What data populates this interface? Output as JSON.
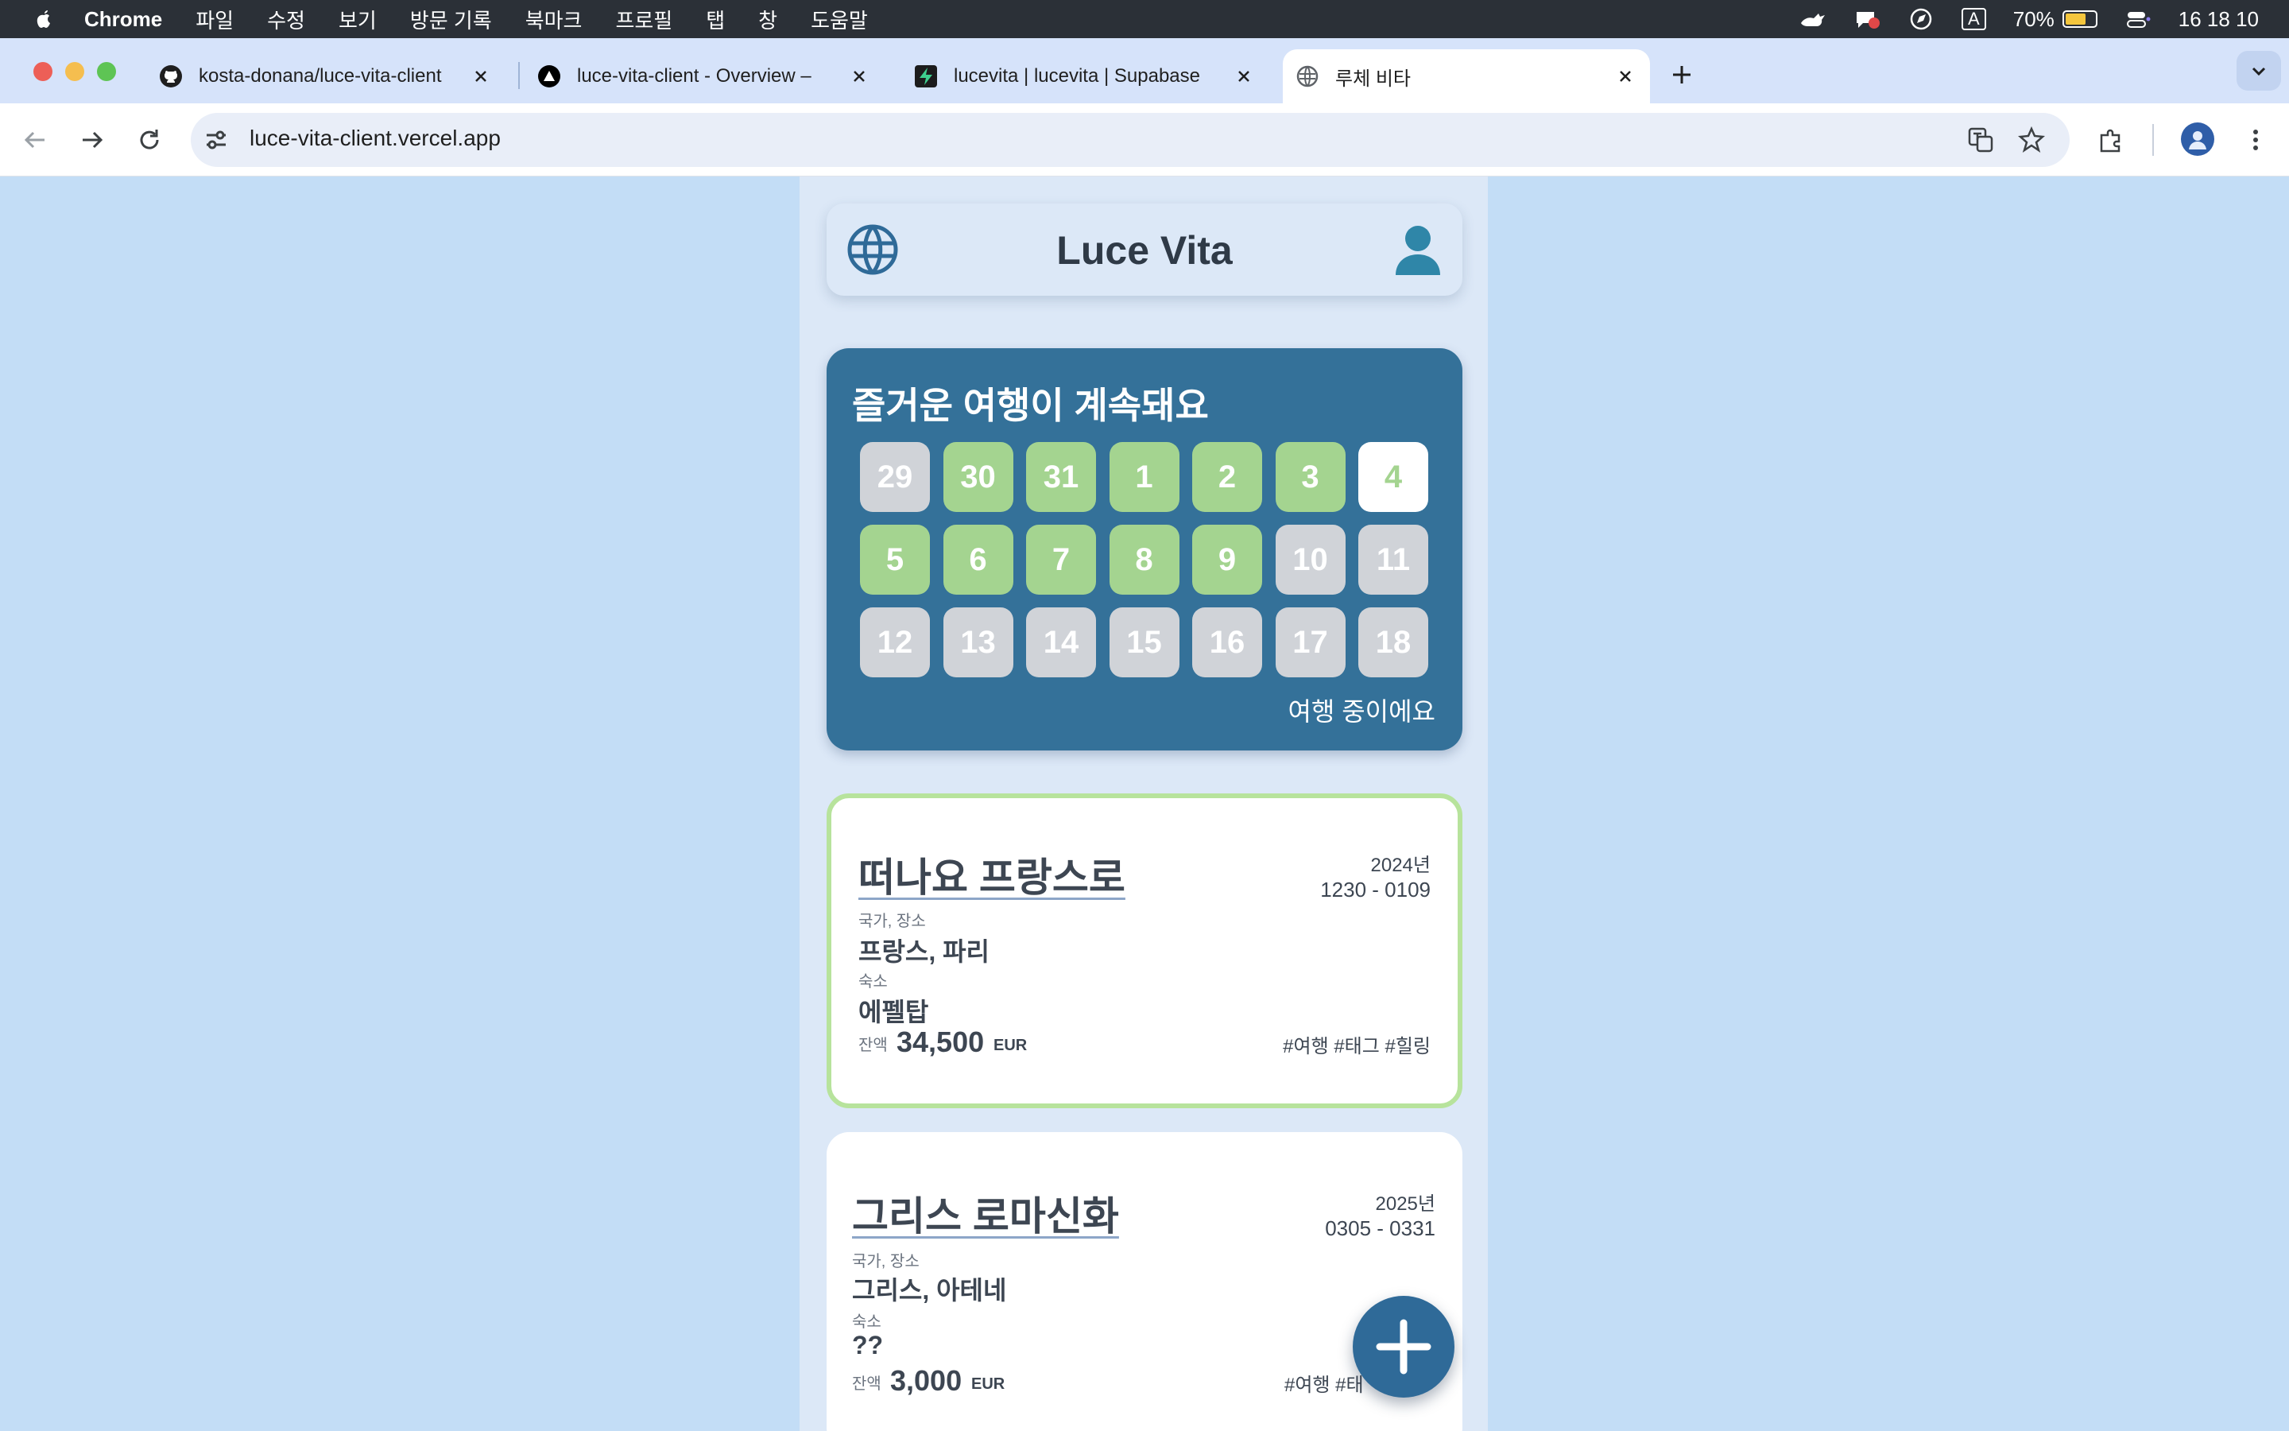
{
  "menubar": {
    "app": "Chrome",
    "items": [
      "파일",
      "수정",
      "보기",
      "방문 기록",
      "북마크",
      "프로필",
      "탭",
      "창",
      "도움말"
    ],
    "battery_percent": "70%",
    "battery_level": 0.7,
    "input_source": "A",
    "clock": "16 18 10"
  },
  "tabs": [
    {
      "title": "kosta-donana/luce-vita-client",
      "icon": "github-icon"
    },
    {
      "title": "luce-vita-client - Overview –",
      "icon": "vercel-icon"
    },
    {
      "title": "lucevita | lucevita | Supabase",
      "icon": "supabase-icon"
    },
    {
      "title": "루체 비타",
      "icon": "globe-icon",
      "active": true
    }
  ],
  "toolbar": {
    "url": "luce-vita-client.vercel.app"
  },
  "app": {
    "brand": "Luce Vita"
  },
  "trip_status": {
    "title": "즐거운 여행이 계속돼요",
    "days": [
      {
        "n": "29",
        "state": "past"
      },
      {
        "n": "30",
        "state": "done"
      },
      {
        "n": "31",
        "state": "done"
      },
      {
        "n": "1",
        "state": "done"
      },
      {
        "n": "2",
        "state": "done"
      },
      {
        "n": "3",
        "state": "done"
      },
      {
        "n": "4",
        "state": "today"
      },
      {
        "n": "5",
        "state": "done"
      },
      {
        "n": "6",
        "state": "done"
      },
      {
        "n": "7",
        "state": "done"
      },
      {
        "n": "8",
        "state": "done"
      },
      {
        "n": "9",
        "state": "done"
      },
      {
        "n": "10",
        "state": "past"
      },
      {
        "n": "11",
        "state": "past"
      },
      {
        "n": "12",
        "state": "past"
      },
      {
        "n": "13",
        "state": "past"
      },
      {
        "n": "14",
        "state": "past"
      },
      {
        "n": "15",
        "state": "past"
      },
      {
        "n": "16",
        "state": "past"
      },
      {
        "n": "17",
        "state": "past"
      },
      {
        "n": "18",
        "state": "past"
      }
    ],
    "caption": "여행 중이에요"
  },
  "trips": [
    {
      "title": "떠나요 프랑스로",
      "year": "2024년",
      "range": "1230 - 0109",
      "place_label": "국가, 장소",
      "place": "프랑스, 파리",
      "lodging_label": "숙소",
      "lodging": "에펠탑",
      "balance_label": "잔액",
      "balance": "34,500",
      "currency": "EUR",
      "tags": "#여행  #태그  #힐링"
    },
    {
      "title": "그리스 로마신화",
      "year": "2025년",
      "range": "0305 - 0331",
      "place_label": "국가, 장소",
      "place": "그리스, 아테네",
      "lodging_label": "숙소",
      "lodging": "??",
      "balance_label": "잔액",
      "balance": "3,000",
      "currency": "EUR",
      "tags": "#여행  #태"
    }
  ],
  "colors": {
    "background": "#c3ddf6",
    "trip_card": "#347199",
    "day_done": "#a4d490",
    "day_past": "#d0d3d8",
    "active_border": "#b7e39c",
    "fab": "#2f6a98"
  }
}
